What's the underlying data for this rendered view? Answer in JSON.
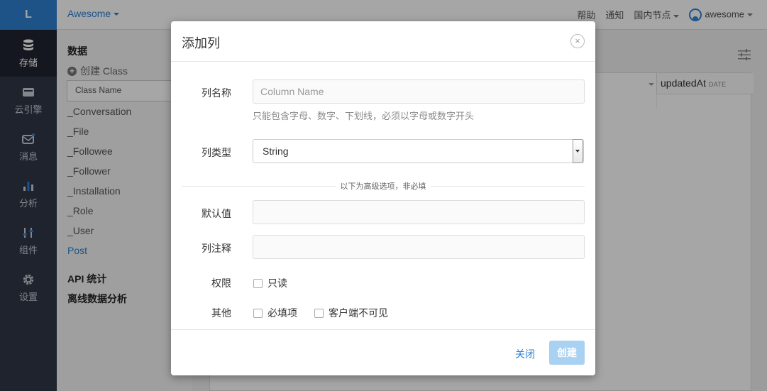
{
  "leftnav": {
    "logo": "L",
    "items": [
      {
        "label": "存储",
        "icon": "database-icon"
      },
      {
        "label": "云引擎",
        "icon": "server-icon"
      },
      {
        "label": "消息",
        "icon": "mail-icon"
      },
      {
        "label": "分析",
        "icon": "bar-chart-icon"
      },
      {
        "label": "组件",
        "icon": "sliders-icon"
      },
      {
        "label": "设置",
        "icon": "gear-icon"
      }
    ]
  },
  "topbar": {
    "app_name": "Awesome",
    "help": "帮助",
    "notify": "通知",
    "region": "国内节点",
    "user": "awesome"
  },
  "sidebar": {
    "data_title": "数据",
    "create_class": "创建 Class",
    "search_placeholder": "Class Name",
    "classes": [
      "_Conversation",
      "_File",
      "_Followee",
      "_Follower",
      "_Installation",
      "_Role",
      "_User",
      "Post"
    ],
    "api_stats": "API 统计",
    "offline_analysis": "离线数据分析"
  },
  "table": {
    "col_name": "updatedAt",
    "col_type": "DATE"
  },
  "modal": {
    "title": "添加列",
    "close_glyph": "×",
    "column_name_label": "列名称",
    "column_name_placeholder": "Column Name",
    "column_name_hint": "只能包含字母、数字、下划线，必须以字母或数字开头",
    "column_type_label": "列类型",
    "column_type_value": "String",
    "advanced_divider": "以下为高级选项，非必填",
    "default_label": "默认值",
    "comment_label": "列注释",
    "permission_label": "权限",
    "readonly_label": "只读",
    "other_label": "其他",
    "required_label": "必填项",
    "client_invisible_label": "客户端不可见",
    "close_button": "关闭",
    "create_button": "创建"
  },
  "colors": {
    "accent": "#2f80d1",
    "nav_bg": "#2f3645",
    "create_disabled": "#a9d1f1"
  }
}
